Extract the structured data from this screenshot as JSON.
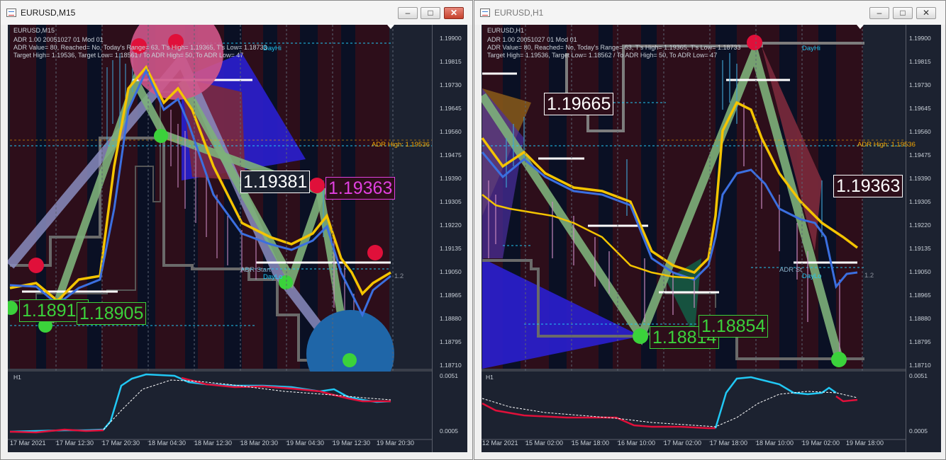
{
  "left": {
    "title": "EURUSD,M15",
    "chart_label": "EURUSD,M15",
    "info": [
      "ADR 1.00 20051027 01 Mod 01",
      "ADR Value= 80, Reached= No, Today's Range= 63, T's High= 1.19365, T's Low= 1.18733",
      "Target High= 1.19536, Target Low= 1.18561 / To ADR High= 50, To ADR Low= 47"
    ],
    "adr_high": "ADR High: 1.19536",
    "adr_start": "ADR Start",
    "day_hi": "DayHi",
    "day_lo": "DayLo",
    "ratio": "1.2",
    "big_labels": {
      "white": "1.19381",
      "magenta": "1.19363",
      "green1": "1.18918",
      "green2": "1.18905"
    },
    "prices": [
      "1.19900",
      "1.19815",
      "1.19730",
      "1.19645",
      "1.19560",
      "1.19475",
      "1.19390",
      "1.19305",
      "1.19220",
      "1.19135",
      "1.19050",
      "1.18965",
      "1.18880",
      "1.18795",
      "1.18710"
    ],
    "sub_name": "H1",
    "sub_prices": [
      "0.0051",
      "0.0005"
    ],
    "dates": [
      "17 Mar 2021",
      "17 Mar 12:30",
      "17 Mar 20:30",
      "18 Mar 04:30",
      "18 Mar 12:30",
      "18 Mar 20:30",
      "19 Mar 04:30",
      "19 Mar 12:30",
      "19 Mar 20:30"
    ]
  },
  "right": {
    "title": "EURUSD,H1",
    "chart_label": "EURUSD,H1",
    "info": [
      "ADR 1.00 20051027 01 Mod 01",
      "ADR Value= 80, Reached= No, Today's Range= 63, T's High= 1.19365, T's Low= 1.18733",
      "Target High= 1.19536, Target Low= 1.18562 / To ADR High= 50, To ADR Low= 47"
    ],
    "adr_high": "ADR High: 1.19536",
    "adr_start": "ADR St",
    "day_hi": "DayHi",
    "day_lo": "DayLo",
    "ratio": "1.2",
    "big_labels": {
      "white1": "1.19665",
      "white2": "1.19363",
      "green1": "1.18814",
      "green2": "1.18854"
    },
    "prices": [
      "1.19900",
      "1.19815",
      "1.19730",
      "1.19645",
      "1.19560",
      "1.19475",
      "1.19390",
      "1.19305",
      "1.19220",
      "1.19135",
      "1.19050",
      "1.18965",
      "1.18880",
      "1.18795",
      "1.18710"
    ],
    "sub_name": "H1",
    "sub_prices": [
      "0.0051",
      "0.0005"
    ],
    "dates": [
      "12 Mar 2021",
      "15 Mar 02:00",
      "15 Mar 18:00",
      "16 Mar 10:00",
      "17 Mar 02:00",
      "17 Mar 18:00",
      "18 Mar 10:00",
      "19 Mar 02:00",
      "19 Mar 18:00"
    ]
  },
  "colors": {
    "bg": "#1c2230",
    "yellow": "#f4c400",
    "blue": "#3b6fe0",
    "green": "#7db07a",
    "red": "#e0103a",
    "greenDot": "#3bd23b",
    "cyan": "#21c8f4",
    "magenta": "#e040e0"
  }
}
